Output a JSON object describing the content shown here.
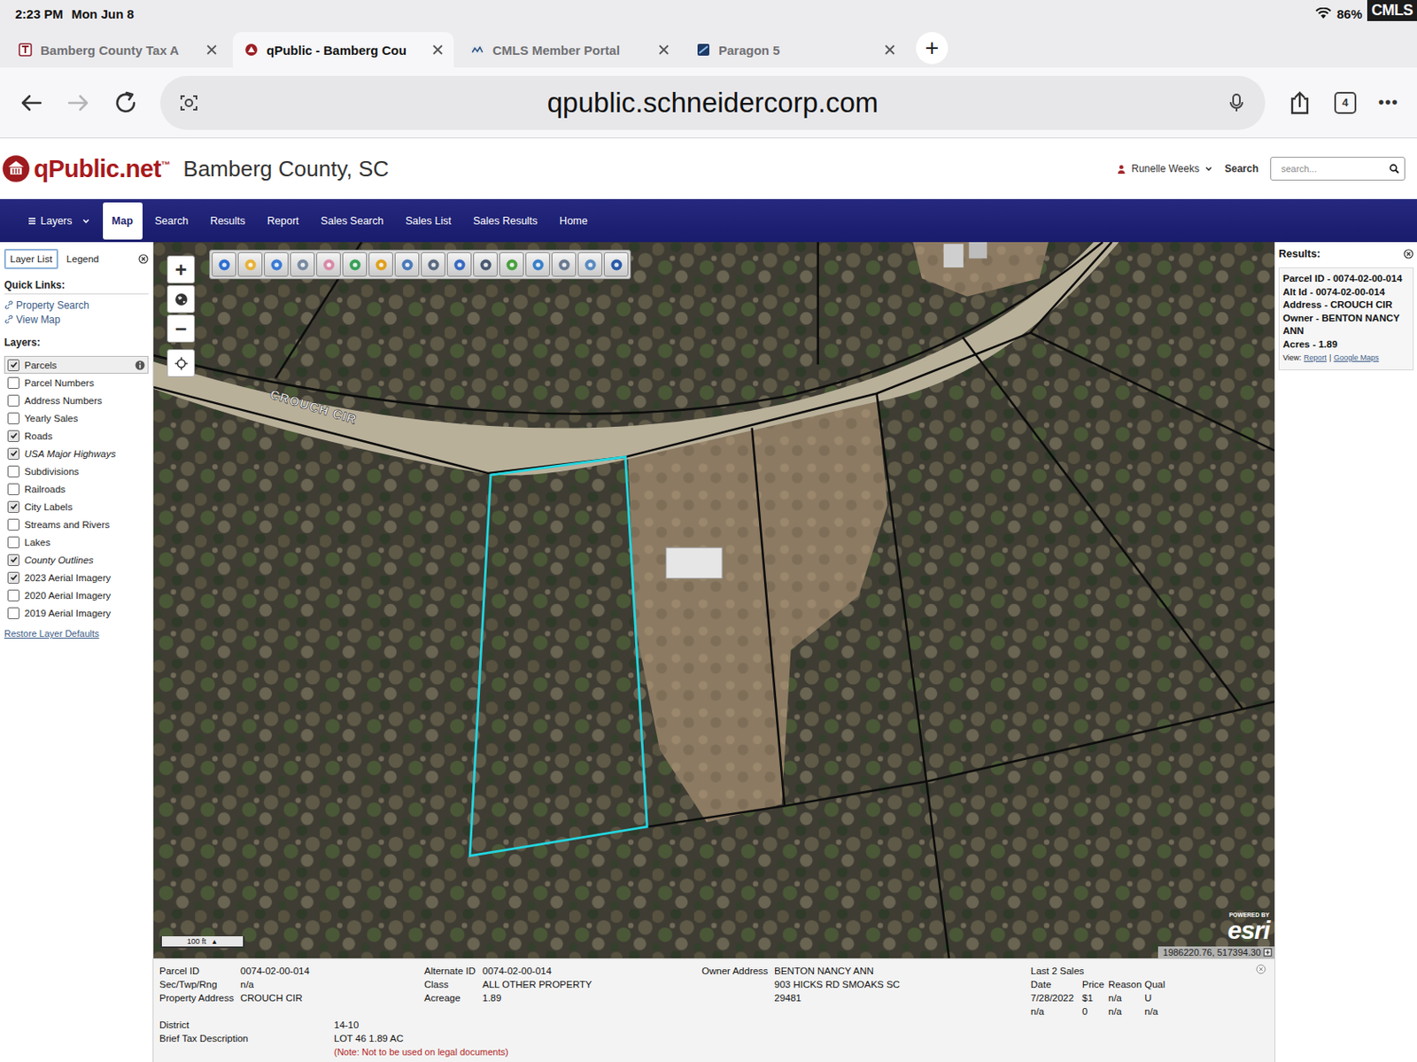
{
  "statusBar": {
    "time": "2:23 PM",
    "date": "Mon Jun 8",
    "battery": "86%",
    "watermark": "CMLS"
  },
  "browser": {
    "tabs": [
      {
        "label": "Bamberg County Tax A",
        "selected": false
      },
      {
        "label": "qPublic - Bamberg Cou",
        "selected": true
      },
      {
        "label": "CMLS Member Portal",
        "selected": false
      },
      {
        "label": "Paragon 5",
        "selected": false
      }
    ],
    "newTab": "+",
    "url": "qpublic.schneidercorp.com",
    "tabCount": "4",
    "more": "•••"
  },
  "site": {
    "logoMain": "qPublic",
    "logoSuffix": ".net",
    "trademark": "™",
    "county": "Bamberg County, SC",
    "user": "Runelle Weeks",
    "searchLabel": "Search",
    "searchPlaceholder": "search..."
  },
  "nav": [
    {
      "label": "Layers",
      "kind": "menu",
      "selected": false
    },
    {
      "label": "Map",
      "kind": "link",
      "selected": true
    },
    {
      "label": "Search",
      "kind": "link",
      "selected": false
    },
    {
      "label": "Results",
      "kind": "link",
      "selected": false
    },
    {
      "label": "Report",
      "kind": "link",
      "selected": false
    },
    {
      "label": "Sales Search",
      "kind": "link",
      "selected": false
    },
    {
      "label": "Sales List",
      "kind": "link",
      "selected": false
    },
    {
      "label": "Sales Results",
      "kind": "link",
      "selected": false
    },
    {
      "label": "Home",
      "kind": "link",
      "selected": false
    }
  ],
  "sidebar": {
    "tabs": [
      {
        "label": "Layer List",
        "selected": true
      },
      {
        "label": "Legend",
        "selected": false
      }
    ],
    "quickLinksTitle": "Quick Links:",
    "quickLinks": [
      "Property Search",
      "View Map"
    ],
    "layersTitle": "Layers:",
    "layers": [
      {
        "label": "Parcels",
        "checked": true,
        "selected": true,
        "italic": false
      },
      {
        "label": "Parcel Numbers",
        "checked": false,
        "selected": false,
        "italic": false
      },
      {
        "label": "Address Numbers",
        "checked": false,
        "selected": false,
        "italic": false
      },
      {
        "label": "Yearly Sales",
        "checked": false,
        "selected": false,
        "italic": false
      },
      {
        "label": "Roads",
        "checked": true,
        "selected": false,
        "italic": false
      },
      {
        "label": "USA Major Highways",
        "checked": true,
        "selected": false,
        "italic": true
      },
      {
        "label": "Subdivisions",
        "checked": false,
        "selected": false,
        "italic": false
      },
      {
        "label": "Railroads",
        "checked": false,
        "selected": false,
        "italic": false
      },
      {
        "label": "City Labels",
        "checked": true,
        "selected": false,
        "italic": false
      },
      {
        "label": "Streams and Rivers",
        "checked": false,
        "selected": false,
        "italic": false
      },
      {
        "label": "Lakes",
        "checked": false,
        "selected": false,
        "italic": false
      },
      {
        "label": "County Outlines",
        "checked": true,
        "selected": false,
        "italic": true
      },
      {
        "label": "2023 Aerial Imagery",
        "checked": true,
        "selected": false,
        "italic": false
      },
      {
        "label": "2020 Aerial Imagery",
        "checked": false,
        "selected": false,
        "italic": false
      },
      {
        "label": "2019 Aerial Imagery",
        "checked": false,
        "selected": false,
        "italic": false
      }
    ],
    "restore": "Restore Layer Defaults"
  },
  "map": {
    "roadLabel": "CROUCH CIR",
    "zoomIn": "+",
    "zoomOut": "−",
    "scale": "100 ft",
    "scaleArrow": "▲",
    "poweredBy": "POWERED BY",
    "esri": "esri",
    "coords": "1986220.76, 517394.30"
  },
  "results": {
    "title": "Results:",
    "lines": [
      "Parcel ID - 0074-02-00-014",
      "Alt Id - 0074-02-00-014",
      "Address - CROUCH CIR",
      "Owner - BENTON NANCY ANN",
      "Acres - 1.89"
    ],
    "viewLabel": "View:",
    "links": [
      "Report",
      "Google Maps"
    ],
    "separator": "|"
  },
  "info": {
    "col1": [
      {
        "label": "Parcel ID",
        "value": "0074-02-00-014"
      },
      {
        "label": "Sec/Twp/Rng",
        "value": "n/a"
      },
      {
        "label": "Property Address",
        "value": "CROUCH CIR"
      }
    ],
    "col2": [
      {
        "label": "Alternate ID",
        "value": "0074-02-00-014"
      },
      {
        "label": "Class",
        "value": "ALL OTHER PROPERTY"
      },
      {
        "label": "Acreage",
        "value": "1.89"
      }
    ],
    "owner": {
      "label": "Owner Address",
      "lines": [
        "BENTON NANCY ANN",
        "903 HICKS RD SMOAKS SC",
        "29481"
      ]
    },
    "sales": {
      "title": "Last 2 Sales",
      "columns": [
        "Date",
        "Price",
        "Reason",
        "Qual"
      ],
      "rows": [
        [
          "7/28/2022",
          "$1",
          "n/a",
          "U"
        ],
        [
          "n/a",
          "0",
          "n/a",
          "n/a"
        ]
      ]
    },
    "extra": [
      {
        "label": "District",
        "value": "14-10"
      },
      {
        "label": "Brief Tax Description",
        "value": "LOT 46 1.89 AC"
      }
    ],
    "note": "(Note: Not to be used on legal documents)"
  }
}
